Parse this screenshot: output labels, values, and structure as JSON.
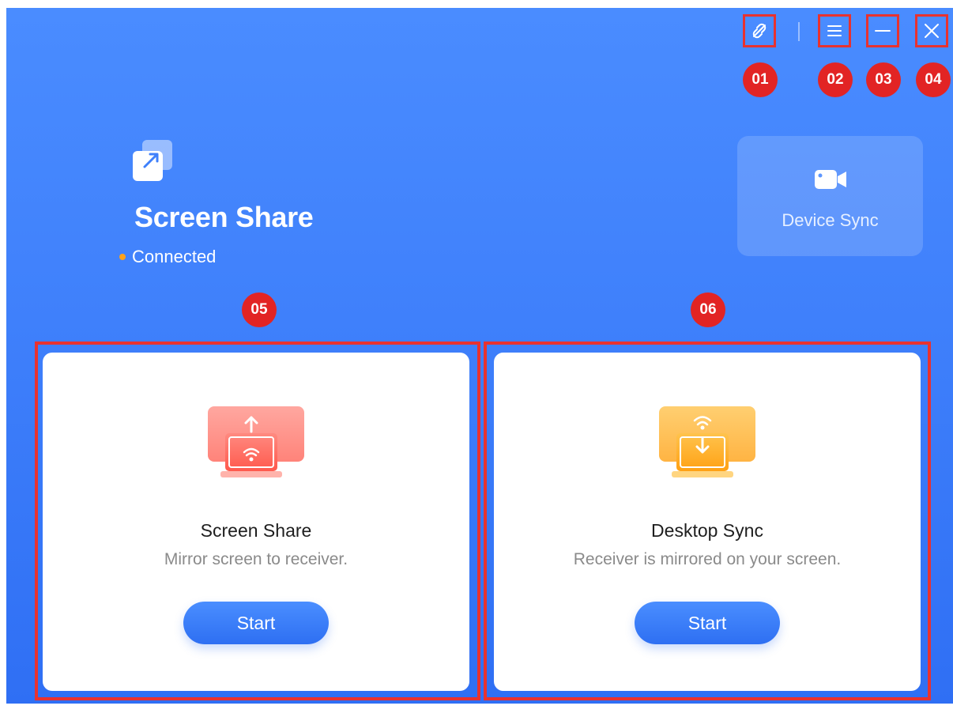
{
  "window": {
    "controls": [
      {
        "icon": "link-off-icon",
        "marker": "01"
      },
      {
        "icon": "menu-icon",
        "marker": "02"
      },
      {
        "icon": "minimize-icon",
        "marker": "03"
      },
      {
        "icon": "close-icon",
        "marker": "04"
      }
    ]
  },
  "header": {
    "icon": "screen-share-app-icon",
    "title": "Screen Share",
    "status": "Connected",
    "status_color": "#ffa21a"
  },
  "device_sync": {
    "icon": "video-camera-icon",
    "label": "Device Sync"
  },
  "cards": [
    {
      "marker": "05",
      "icon": "screen-share-illustration",
      "title": "Screen Share",
      "description": "Mirror screen to receiver.",
      "button": "Start",
      "accent": "#ff6b5e"
    },
    {
      "marker": "06",
      "icon": "desktop-sync-illustration",
      "title": "Desktop Sync",
      "description": "Receiver is mirrored on your screen.",
      "button": "Start",
      "accent": "#ffb01f"
    }
  ],
  "colors": {
    "background": "#3f80fb",
    "annotation": "#e8322f",
    "button": "#2e6ff2"
  }
}
